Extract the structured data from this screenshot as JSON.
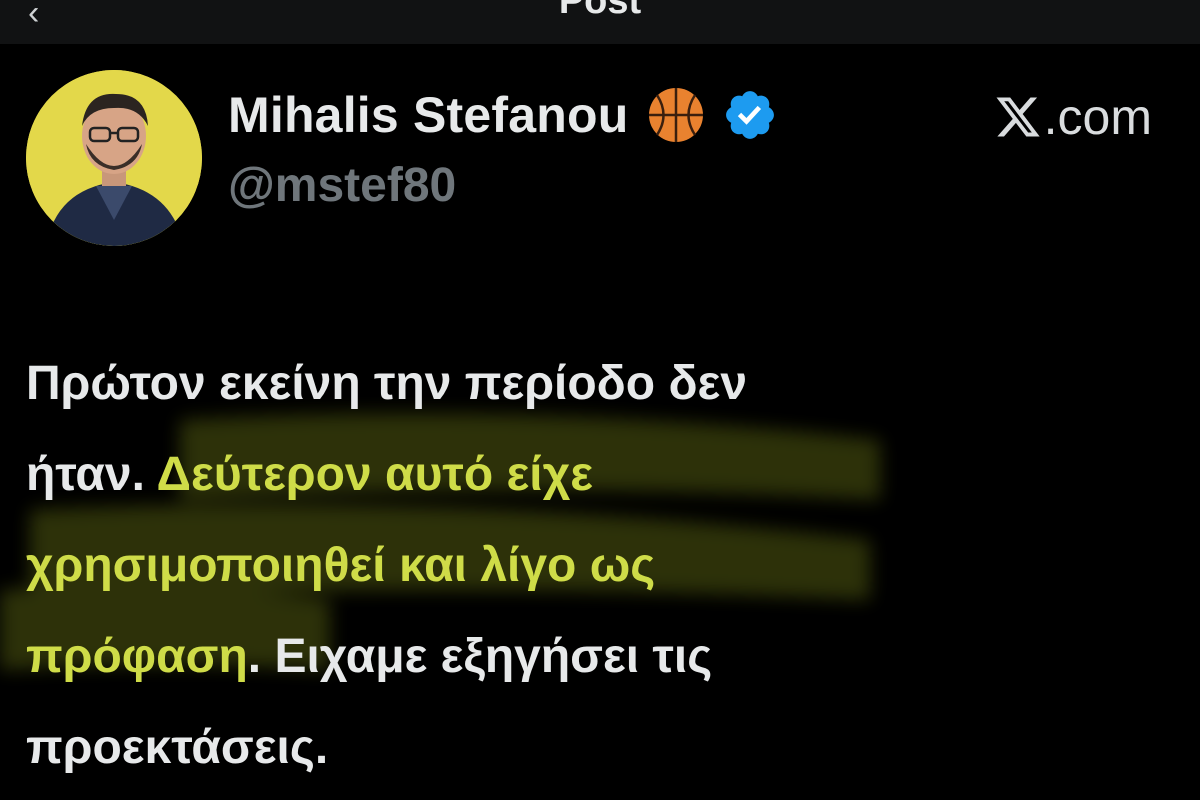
{
  "top_bar": {
    "title": "Post",
    "back_icon": "chevron-left-icon"
  },
  "author": {
    "display_name": "Mihalis Stefanou",
    "emoji": "basketball-emoji",
    "verified": true,
    "verified_color": "#1d9bf0",
    "handle": "@mstef80"
  },
  "brand": {
    "label": ".com",
    "icon": "x-logo-icon"
  },
  "tweet": {
    "line1": "Πρώτον εκείνη την περίοδο δεν",
    "line2_plain": "ήταν. ",
    "line2_hl": "Δεύτερον αυτό είχε",
    "line3_hl": "χρησιμοποιηθεί και λίγο ως",
    "line4_hl": "πρόφαση",
    "line4_plain": ". Ειχαμε εξηγήσει τις",
    "line5": "προεκτάσεις."
  },
  "colors": {
    "background": "#000000",
    "text": "#e7e9ea",
    "muted": "#6f767b",
    "highlight_text": "#cfdc48",
    "highlight_marker": "#8b9a1e",
    "avatar_bg": "#e3d84a"
  }
}
